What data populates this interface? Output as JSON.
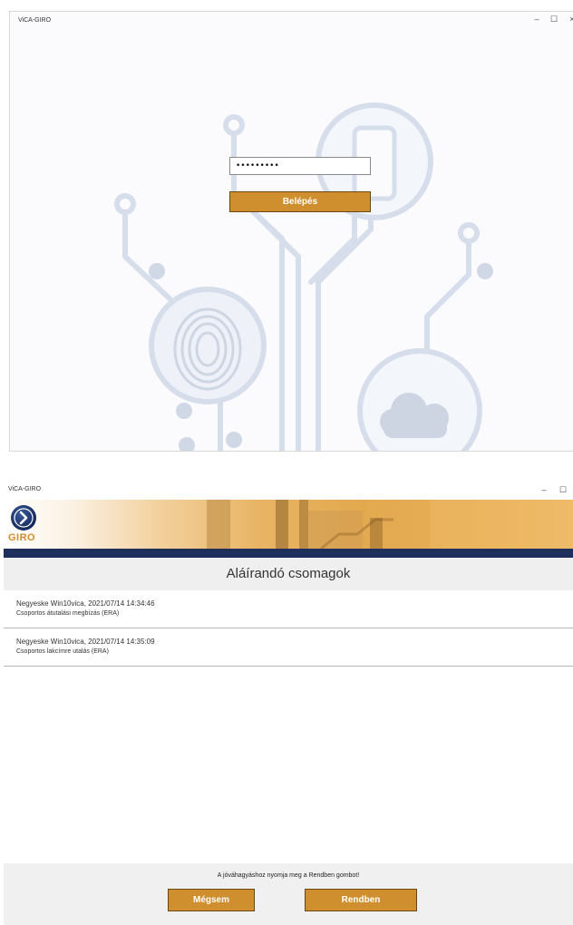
{
  "login_window": {
    "title": "ViCA-GIRO",
    "controls": {
      "minimize": "–",
      "maximize": "☐",
      "close": "×"
    },
    "password_value": "•••••••••",
    "login_button": "Belépés"
  },
  "packages_window": {
    "title": "ViCA-GIRO",
    "controls": {
      "minimize": "–",
      "maximize": "☐",
      "close": "×"
    },
    "logo_text": "GIRO",
    "heading": "Aláírandó csomagok",
    "items": [
      {
        "title": "Negyeske Win10vica, 2021/07/14 14:34:46",
        "subtitle": "Csoportos átutalási megbízás (ERA)"
      },
      {
        "title": "Negyeske Win10vica, 2021/07/14 14:35:09",
        "subtitle": "Csoportos lakcímre utalás (ERA)"
      }
    ],
    "hint": "A jóváhagyáshoz nyomja meg a Rendben gombot!",
    "cancel_button": "Mégsem",
    "ok_button": "Rendben"
  },
  "colors": {
    "accent_button": "#d08f2f",
    "nav_bar": "#1f2f5c",
    "illustration": "#d3dbe9"
  },
  "icons": [
    "fingerprint-icon",
    "phone-icon",
    "cloud-icon",
    "chevron-right-icon"
  ]
}
